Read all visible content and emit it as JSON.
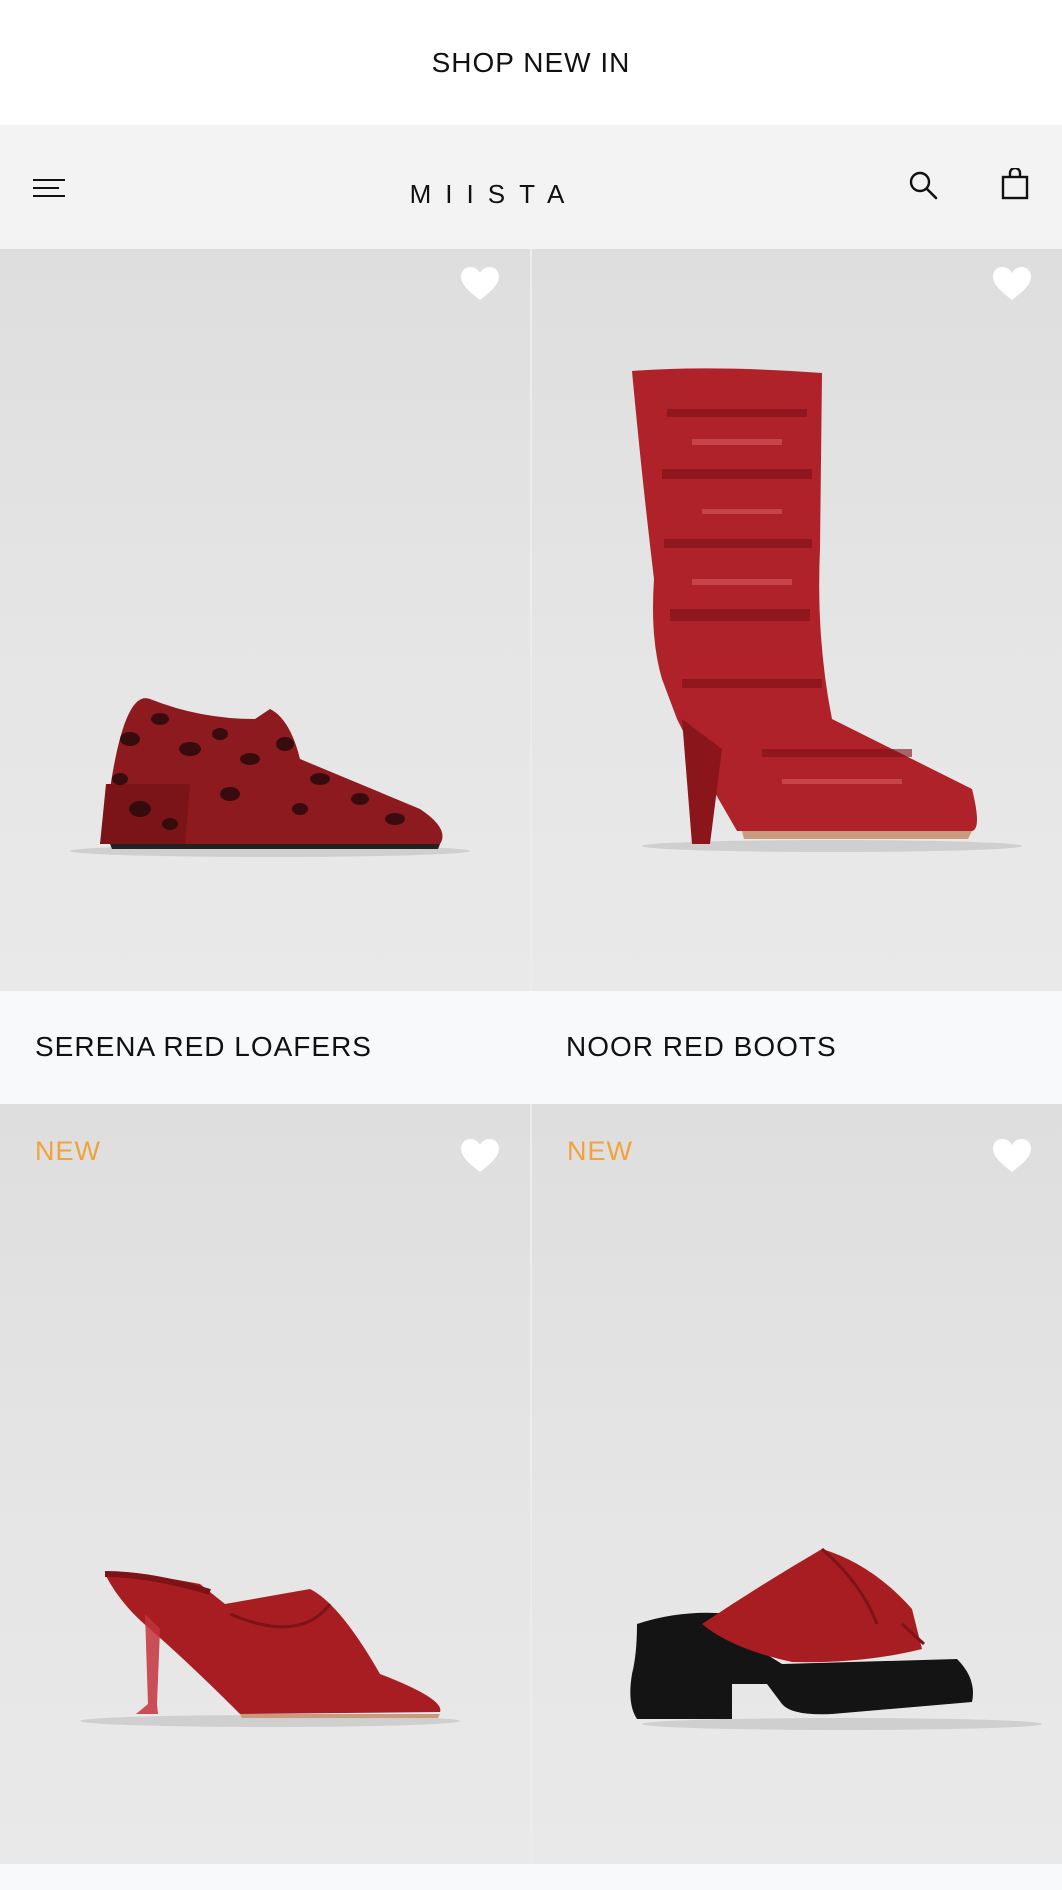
{
  "banner": {
    "label": "SHOP NEW IN"
  },
  "header": {
    "logo": "MIISTA",
    "menu_icon": "menu-icon",
    "search_icon": "search-icon",
    "cart_icon": "shopping-bag-icon"
  },
  "products": [
    {
      "name": "SERENA RED LOAFERS",
      "badge": "",
      "image_icon": "loafer-image",
      "wishlist_icon": "heart-icon"
    },
    {
      "name": "NOOR RED BOOTS",
      "badge": "",
      "image_icon": "boot-image",
      "wishlist_icon": "heart-icon"
    },
    {
      "name": "",
      "badge": "NEW",
      "image_icon": "mule-heel-image",
      "wishlist_icon": "heart-icon"
    },
    {
      "name": "",
      "badge": "NEW",
      "image_icon": "platform-mule-image",
      "wishlist_icon": "heart-icon"
    }
  ],
  "colors": {
    "badge": "#f2a23a",
    "tile_bg": "#e6e6e6",
    "header_bg": "#f3f3f3",
    "name_row_bg": "#f8f9fb",
    "shoe_red": "#a81d22"
  }
}
